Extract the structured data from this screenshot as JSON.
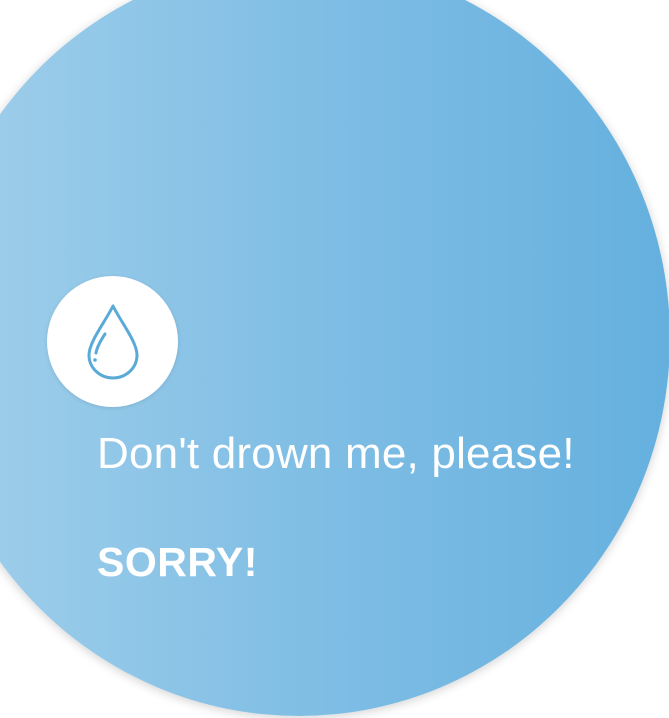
{
  "notification": {
    "message": "Don't drown me, please!",
    "action_label": "SORRY!",
    "icon": "water-drop-icon"
  },
  "colors": {
    "gradient_start": "#a2d0eb",
    "gradient_end": "#65b0df",
    "icon_stroke": "#5aaad8",
    "text": "#ffffff",
    "icon_background": "#ffffff"
  }
}
